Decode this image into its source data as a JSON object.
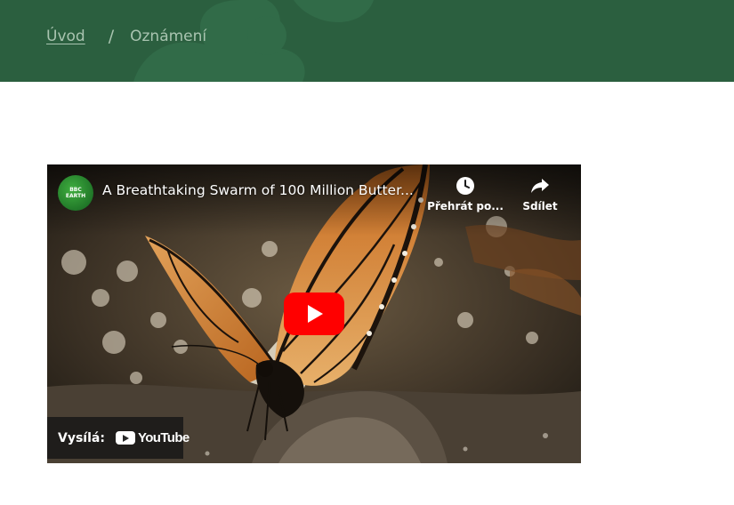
{
  "breadcrumb": {
    "home_label": "Úvod",
    "separator": "/",
    "current_label": "Oznámení"
  },
  "video": {
    "title": "A Breathtaking Swarm of 100 Million Butter...",
    "channel_badge_line1": "BBC",
    "channel_badge_line2": "EARTH",
    "watch_later_label": "Přehrát po...",
    "share_label": "Sdílet",
    "watch_on_label": "Vysílá:",
    "youtube_wordmark": "YouTube"
  },
  "colors": {
    "header_bg": "#2b5f3f",
    "breadcrumb_text": "#a9c4b0",
    "play_button": "#ff0000"
  },
  "icons": {
    "watch_later": "clock-icon",
    "share": "share-arrow-icon",
    "play": "play-icon",
    "logo": "youtube-logo-icon"
  }
}
